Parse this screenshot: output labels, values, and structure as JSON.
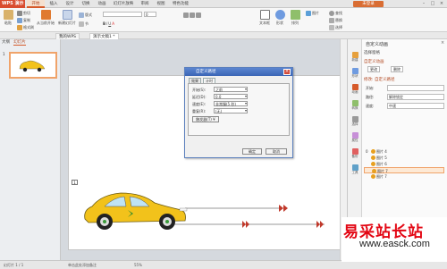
{
  "titlebar": {
    "app_name": "WPS 演示",
    "tabs": [
      "开始",
      "插入",
      "设计",
      "切换",
      "动画",
      "幻灯片放映",
      "审阅",
      "视图",
      "特色功能"
    ],
    "active_tab": "开始",
    "user_button": "未登录",
    "controls": [
      "–",
      "□",
      "×"
    ]
  },
  "ribbon": {
    "paste": "粘贴",
    "cut": "剪切",
    "copy": "复制",
    "format_painter": "格式刷",
    "from_current": "从当前开始",
    "new_slide": "新建幻灯片",
    "layout": "版式",
    "section": "节",
    "font_name": "",
    "font_size": "0",
    "textbox": "文本框",
    "shape": "形状",
    "arrange": "排列",
    "picture": "图片",
    "find": "查找",
    "replace": "替换",
    "select": "选择"
  },
  "doc_tabs": [
    "我的WPS",
    "演示文稿1 *"
  ],
  "left_pane": {
    "tabs": [
      "大纲",
      "幻灯片"
    ],
    "active_tab": "幻灯片",
    "slide_number": "1"
  },
  "slide": {
    "label_marker": "1"
  },
  "dialog": {
    "title": "自定义路径",
    "tabs": [
      "效果",
      "计时"
    ],
    "active_tab": "计时",
    "rows": [
      {
        "label": "开始(S):",
        "value": "之前"
      },
      {
        "label": "延迟(D):",
        "value": "0.0"
      },
      {
        "label": "速度(E):",
        "value": "非常慢(5 秒)"
      },
      {
        "label": "重复(R):",
        "value": "(无)"
      }
    ],
    "trigger_button": "触发器(T) ¥",
    "ok": "确定",
    "cancel": "取消"
  },
  "right_pane": {
    "title": "自定义动画",
    "close": "×",
    "select_pane": "选择窗格",
    "custom_anim_header": "自定义动画",
    "change_button": "更改",
    "delete_button": "删除",
    "modify_header": "修改: 自定义路径",
    "start_label": "开始:",
    "start_value": "",
    "path_label": "路径:",
    "path_value": "解除锁定",
    "speed_label": "速度:",
    "speed_value": "中速",
    "side_icons": [
      "新建",
      "形状",
      "动画",
      "转换",
      "选择",
      "属性",
      "备份",
      "工具"
    ],
    "anim_items": [
      {
        "num": "0",
        "name": "图片 4",
        "selected": false
      },
      {
        "num": "",
        "name": "图片 5",
        "selected": false
      },
      {
        "num": "",
        "name": "图片 6",
        "selected": false
      },
      {
        "num": "",
        "name": "图片 7",
        "selected": true
      },
      {
        "num": "",
        "name": "图片 7",
        "selected": false
      }
    ]
  },
  "statusbar": {
    "slide_info": "幻灯片 1 / 1",
    "notes": "单击此处添加备注",
    "zoom": "55%"
  },
  "watermark": {
    "big": "易采站长站",
    "small": "www.easck.com"
  },
  "colors": {
    "accent": "#d65a2a",
    "car_body": "#f2c21b",
    "dialog_title": "#3a65b5",
    "watermark_red": "#e30613"
  }
}
